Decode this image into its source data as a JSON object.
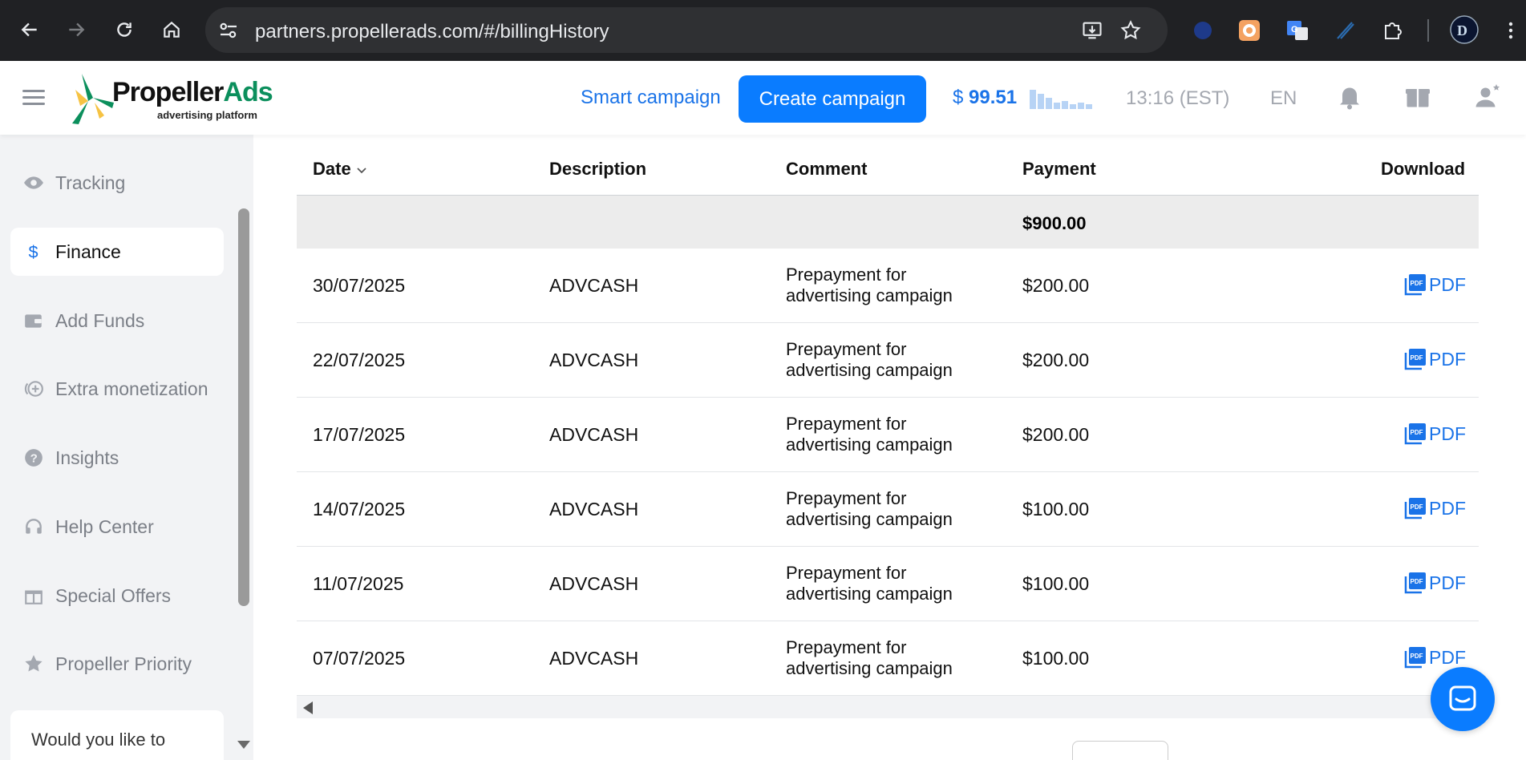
{
  "browser": {
    "url": "partners.propellerads.com/#/billingHistory"
  },
  "header": {
    "logo_main": "Propeller",
    "logo_accent": "Ads",
    "logo_sub": "advertising platform",
    "smart_campaign": "Smart campaign",
    "create_campaign": "Create campaign",
    "balance_symbol": "$",
    "balance_value": "99.51",
    "clock": "13:16 (EST)",
    "language": "EN",
    "colors": {
      "accent": "#0a7cff",
      "link": "#1a73e8",
      "logo_green": "#0b8f5c"
    }
  },
  "sidebar": {
    "items": [
      {
        "label": "Tracking",
        "icon": "eye-icon",
        "active": false
      },
      {
        "label": "Finance",
        "icon": "dollar-icon",
        "active": true
      },
      {
        "label": "Add Funds",
        "icon": "wallet-icon",
        "active": false
      },
      {
        "label": "Extra monetization",
        "icon": "coin-plus-icon",
        "active": false
      },
      {
        "label": "Insights",
        "icon": "question-icon",
        "active": false
      },
      {
        "label": "Help Center",
        "icon": "headset-icon",
        "active": false
      },
      {
        "label": "Special Offers",
        "icon": "gift-box-icon",
        "active": false
      },
      {
        "label": "Propeller Priority",
        "icon": "star-icon",
        "active": false
      }
    ],
    "promo_text": "Would you like to"
  },
  "table": {
    "columns": {
      "date": "Date",
      "description": "Description",
      "comment": "Comment",
      "payment": "Payment",
      "download": "Download"
    },
    "total": "$900.00",
    "rows": [
      {
        "date": "30/07/2025",
        "description": "ADVCASH",
        "comment_line1": "Prepayment for",
        "comment_line2": "advertising campaign",
        "payment": "$200.00",
        "download": "PDF"
      },
      {
        "date": "22/07/2025",
        "description": "ADVCASH",
        "comment_line1": "Prepayment for",
        "comment_line2": "advertising campaign",
        "payment": "$200.00",
        "download": "PDF"
      },
      {
        "date": "17/07/2025",
        "description": "ADVCASH",
        "comment_line1": "Prepayment for",
        "comment_line2": "advertising campaign",
        "payment": "$200.00",
        "download": "PDF"
      },
      {
        "date": "14/07/2025",
        "description": "ADVCASH",
        "comment_line1": "Prepayment for",
        "comment_line2": "advertising campaign",
        "payment": "$100.00",
        "download": "PDF"
      },
      {
        "date": "11/07/2025",
        "description": "ADVCASH",
        "comment_line1": "Prepayment for",
        "comment_line2": "advertising campaign",
        "payment": "$100.00",
        "download": "PDF"
      },
      {
        "date": "07/07/2025",
        "description": "ADVCASH",
        "comment_line1": "Prepayment for",
        "comment_line2": "advertising campaign",
        "payment": "$100.00",
        "download": "PDF"
      }
    ]
  }
}
